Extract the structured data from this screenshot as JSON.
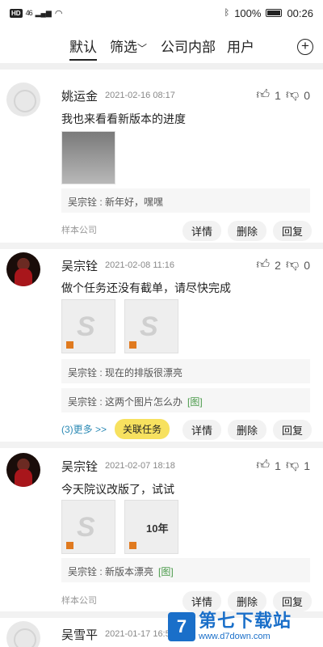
{
  "status_bar": {
    "left_icons": "HD",
    "signal": "46",
    "battery": "100%",
    "time": "00:26"
  },
  "tabs": [
    "默认",
    "筛选",
    "公司内部",
    "用户"
  ],
  "filter_chevron": "chevron-down-icon",
  "posts": [
    {
      "author": "姚运金",
      "time": "2021-02-16 08:17",
      "likes": "1",
      "dislikes": "0",
      "text": "我也来看看新版本的进度",
      "comments": [
        {
          "text": "吴宗铨 : 新年好，嘿嘿",
          "link": ""
        }
      ],
      "company": "样本公司",
      "actions": [
        "详情",
        "删除",
        "回复"
      ]
    },
    {
      "author": "吴宗铨",
      "time": "2021-02-08 11:16",
      "likes": "2",
      "dislikes": "0",
      "text": "做个任务还没有截单，请尽快完成",
      "comments": [
        {
          "text": "吴宗铨 : 现在的排版很漂亮",
          "link": ""
        },
        {
          "text": "吴宗铨 : 这两个图片怎么办",
          "link": "[图]"
        }
      ],
      "more": "(3)更多 >>",
      "task_button": "关联任务",
      "actions": [
        "详情",
        "删除",
        "回复"
      ]
    },
    {
      "author": "吴宗铨",
      "time": "2021-02-07 18:18",
      "likes": "1",
      "dislikes": "1",
      "text": "今天院议改版了，试试",
      "comments": [
        {
          "text": "吴宗铨 : 新版本漂亮",
          "link": "[图]"
        }
      ],
      "company": "样本公司",
      "actions": [
        "详情",
        "删除",
        "回复"
      ]
    },
    {
      "author": "吴雪平",
      "time": "2021-01-17 16:5"
    }
  ],
  "image_year_text": "10年",
  "watermark": {
    "title": "第七下载站",
    "url": "www.d7down.com"
  }
}
